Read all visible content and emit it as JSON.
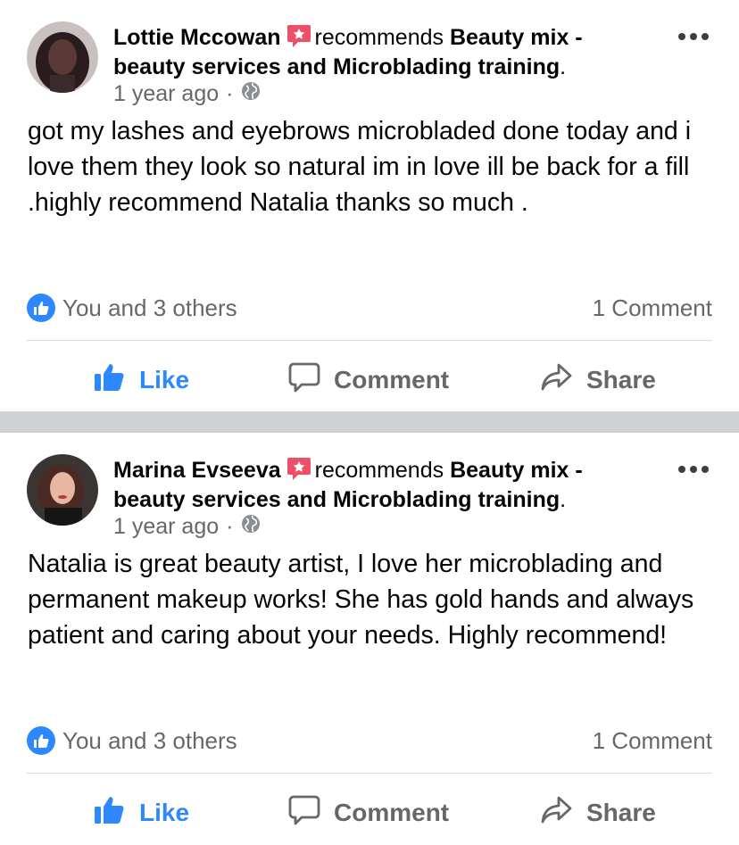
{
  "colors": {
    "facebook_blue": "#2d88ff",
    "secondary_text": "#65676b",
    "recommend_red": "#ed4f67",
    "separator": "#ced0d4"
  },
  "posts": [
    {
      "author": "Lottie Mccowan",
      "verb": "recommends",
      "page": "Beauty mix - beauty services and Microblading training",
      "page_suffix": ".",
      "time": "1 year ago",
      "dot": "·",
      "privacy_icon": "globe-icon",
      "text": "got my lashes and eyebrows microbladed done today and i love them they look so natural im in love ill be back for a fill .highly recommend Natalia thanks so much .",
      "reactions": "You and 3 others",
      "comments": "1 Comment",
      "actions": {
        "like": "Like",
        "comment": "Comment",
        "share": "Share"
      }
    },
    {
      "author": "Marina Evseeva",
      "verb": "recommends",
      "page": "Beauty mix - beauty services and Microblading training",
      "page_suffix": ".",
      "time": "1 year ago",
      "dot": "·",
      "privacy_icon": "globe-icon",
      "text": "Natalia is great beauty artist, I love her microblading and permanent makeup works! She has gold hands and always patient and caring about your needs. Highly recommend!",
      "reactions": "You and 3 others",
      "comments": "1 Comment",
      "actions": {
        "like": "Like",
        "comment": "Comment",
        "share": "Share"
      }
    }
  ]
}
